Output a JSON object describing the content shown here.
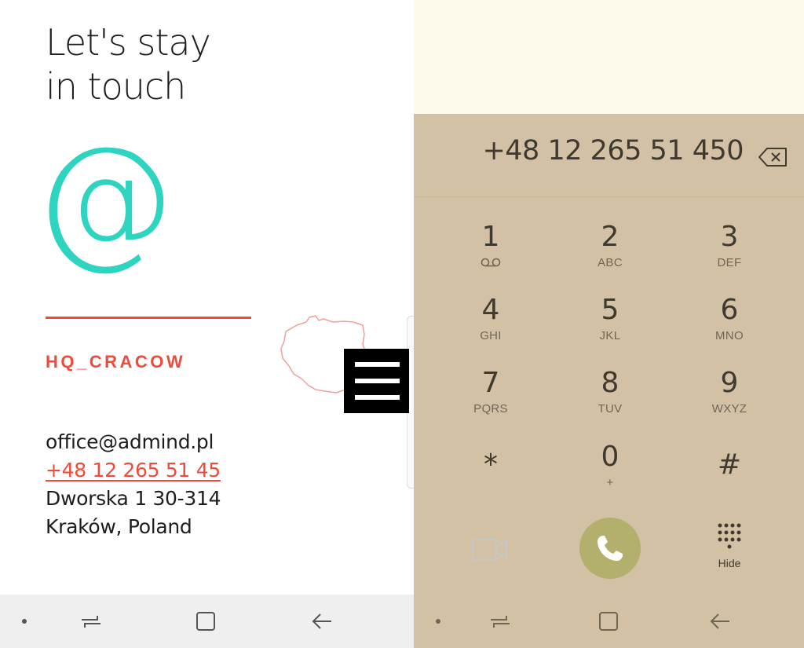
{
  "contact": {
    "heading_line1": "Let's stay",
    "heading_line2": "in touch",
    "at_symbol": "@",
    "office_label": "HQ_CRACOW",
    "email": "office@admind.pl",
    "phone": "+48 12 265 51 45",
    "address_line1": "Dworska 1 30-314",
    "address_line2": "Kraków, Poland",
    "menu_icon": "hamburger-menu-icon",
    "map_icon": "poland-map-outline-icon"
  },
  "dialer": {
    "number": "+48 12 265 51 450",
    "backspace_icon": "backspace-icon",
    "keys": [
      {
        "digit": "1",
        "sub": ""
      },
      {
        "digit": "2",
        "sub": "ABC"
      },
      {
        "digit": "3",
        "sub": "DEF"
      },
      {
        "digit": "4",
        "sub": "GHI"
      },
      {
        "digit": "5",
        "sub": "JKL"
      },
      {
        "digit": "6",
        "sub": "MNO"
      },
      {
        "digit": "7",
        "sub": "PQRS"
      },
      {
        "digit": "8",
        "sub": "TUV"
      },
      {
        "digit": "9",
        "sub": "WXYZ"
      },
      {
        "digit": "*",
        "sub": ""
      },
      {
        "digit": "0",
        "sub": "+"
      },
      {
        "digit": "#",
        "sub": ""
      }
    ],
    "hide_label": "Hide",
    "call_icon": "phone-handset-icon",
    "video_icon": "video-call-icon"
  },
  "colors": {
    "accent_red": "#ee4b3b",
    "accent_teal": "#2dd4c0",
    "dialer_bg": "#d3c1a5",
    "call_green": "#b3af6c"
  }
}
